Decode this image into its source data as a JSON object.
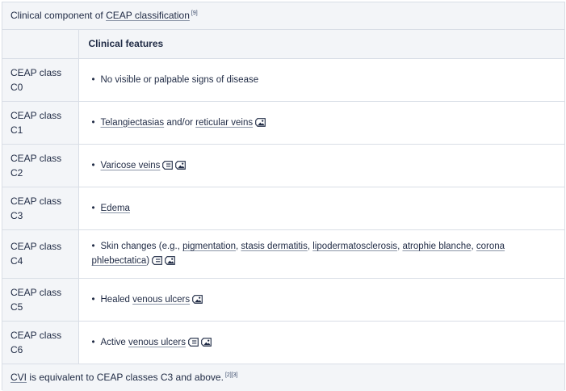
{
  "title": {
    "prefix": "Clinical component of ",
    "link": "CEAP classification",
    "ref": "[9]"
  },
  "table": {
    "column_header": "Clinical features",
    "rows": [
      {
        "label": "CEAP class C0",
        "parts": [
          {
            "text": "No visible or palpable signs of disease",
            "link": false
          }
        ],
        "icons": []
      },
      {
        "label": "CEAP class C1",
        "parts": [
          {
            "text": "Telangiectasias",
            "link": true
          },
          {
            "text": " and/or ",
            "link": false
          },
          {
            "text": "reticular veins",
            "link": true
          }
        ],
        "icons": [
          "image-icon"
        ]
      },
      {
        "label": "CEAP class C2",
        "parts": [
          {
            "text": "Varicose veins",
            "link": true
          }
        ],
        "icons": [
          "article-icon",
          "image-icon"
        ]
      },
      {
        "label": "CEAP class C3",
        "parts": [
          {
            "text": "Edema",
            "link": true
          }
        ],
        "icons": []
      },
      {
        "label": "CEAP class C4",
        "parts": [
          {
            "text": "Skin changes (e.g., ",
            "link": false
          },
          {
            "text": "pigmentation",
            "link": true
          },
          {
            "text": ", ",
            "link": false
          },
          {
            "text": "stasis dermatitis",
            "link": true
          },
          {
            "text": ", ",
            "link": false
          },
          {
            "text": "lipodermatosclerosis",
            "link": true
          },
          {
            "text": ", ",
            "link": false
          },
          {
            "text": "atrophie blanche",
            "link": true
          },
          {
            "text": ", ",
            "link": false
          },
          {
            "text": "corona phlebectatica",
            "link": true
          },
          {
            "text": ")",
            "link": false
          }
        ],
        "icons": [
          "article-icon",
          "image-icon"
        ]
      },
      {
        "label": "CEAP class C5",
        "parts": [
          {
            "text": "Healed ",
            "link": false
          },
          {
            "text": "venous ulcers",
            "link": true
          }
        ],
        "icons": [
          "image-icon"
        ]
      },
      {
        "label": "CEAP class C6",
        "parts": [
          {
            "text": "Active ",
            "link": false
          },
          {
            "text": "venous ulcers",
            "link": true
          }
        ],
        "icons": [
          "article-icon",
          "image-icon"
        ]
      }
    ]
  },
  "footer": {
    "link": "CVI",
    "text": " is equivalent to CEAP classes C3 and above.",
    "ref": "[2][3]"
  }
}
